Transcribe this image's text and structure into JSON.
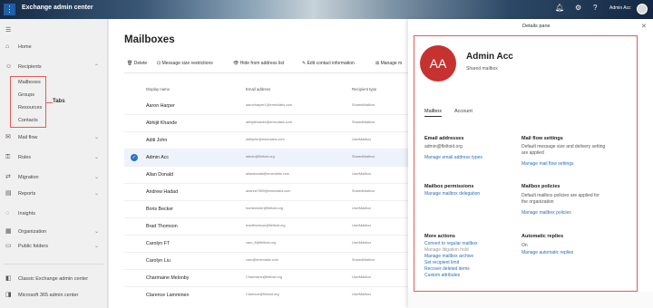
{
  "app": {
    "title": "Exchange admin center",
    "user_name": "Admin Acc"
  },
  "nav": {
    "items": [
      {
        "label": "Home",
        "icon": "home-icon"
      },
      {
        "label": "Recipients",
        "icon": "person-icon"
      },
      {
        "label": "Mail flow",
        "icon": "mail-icon"
      },
      {
        "label": "Roles",
        "icon": "key-icon"
      },
      {
        "label": "Migration",
        "icon": "swap-icon"
      },
      {
        "label": "Reports",
        "icon": "chart-icon"
      },
      {
        "label": "Insights",
        "icon": "bulb-icon"
      },
      {
        "label": "Organization",
        "icon": "building-icon"
      },
      {
        "label": "Public folders",
        "icon": "folder-icon"
      },
      {
        "label": "Classic Exchange admin center",
        "icon": "exchange-icon"
      },
      {
        "label": "Microsoft 365 admin center",
        "icon": "office-icon"
      }
    ],
    "sub_items": [
      "Mailboxes",
      "Groups",
      "Resources",
      "Contacts"
    ],
    "annotation": "Tabs"
  },
  "main": {
    "title": "Mailboxes",
    "commands": [
      "Delete",
      "Message size restrictions",
      "Hide from address list",
      "Edit contact information",
      "Manage m"
    ],
    "columns": [
      "Display name",
      "Email address",
      "Recipient type"
    ],
    "rows": [
      {
        "name": "Aaron Harper",
        "email": "aaronharper1@emeolabs.com",
        "type": "SharedMailbox"
      },
      {
        "name": "Abhijit Khande",
        "email": "abhijitkhande@emeolabs.com",
        "type": "SharedMailbox"
      },
      {
        "name": "Aditi John",
        "email": "aditijohn@emeolabs.com",
        "type": "UserMailbox"
      },
      {
        "name": "Admin Acc",
        "email": "admin@fleltoid.org",
        "type": "SharedMailbox"
      },
      {
        "name": "Allan Donald",
        "email": "allandonald@emeolabs.com",
        "type": "UserMailbox"
      },
      {
        "name": "Andrew Hadad",
        "email": "andrew7890@emeolabs.com",
        "type": "SharedMailbox"
      },
      {
        "name": "Boris Becker",
        "email": "borisbecker@fleltoid.org",
        "type": "UserMailbox"
      },
      {
        "name": "Brad Thomson",
        "email": "bradthomson@fleltoid.org",
        "type": "UserMailbox"
      },
      {
        "name": "Carolyn FT",
        "email": "caro_ft@fleltoid.org",
        "type": "UserMailbox"
      },
      {
        "name": "Carolyn Liu",
        "email": "caro@emeolabs.com",
        "type": "SharedMailbox"
      },
      {
        "name": "Charmaine Melonby",
        "email": "Charmaine@fleltoid.org",
        "type": "UserMailbox"
      },
      {
        "name": "Clarence Lamminen",
        "email": "Clarence@fleltoid.org",
        "type": "UserMailbox"
      }
    ]
  },
  "details": {
    "label": "Details pane",
    "initials": "AA",
    "avatar_color": "#c6322f",
    "name": "Admin Acc",
    "subtitle": "Shared mailbox",
    "tabs": [
      "Mailbox",
      "Account"
    ],
    "email_heading": "Email addresses",
    "email_value": "admin@fleltoid.org",
    "email_link": "Manage email address types",
    "mailflow_heading": "Mail flow settings",
    "mailflow_text": "Default message size and delivery setting are applied",
    "mailflow_link": "Manage mail flow settings",
    "perm_heading": "Mailbox permissions",
    "perm_link": "Manage mailbox delegation",
    "policy_heading": "Mailbox policies",
    "policy_text": "Default mailbox policies are applied for the organization",
    "policy_link": "Manage mailbox policies",
    "more_heading": "More actions",
    "more_links": [
      "Convert to regular mailbox",
      "Manage litigation hold",
      "Manage mailbox archive",
      "Set recipient limit",
      "Recover deleted items",
      "Custom attributes"
    ],
    "auto_heading": "Automatic replies",
    "auto_value": "On",
    "auto_link": "Manage automatic replies"
  },
  "colors": {
    "accent": "#2a6fc0",
    "highlight": "#e35b5b"
  }
}
